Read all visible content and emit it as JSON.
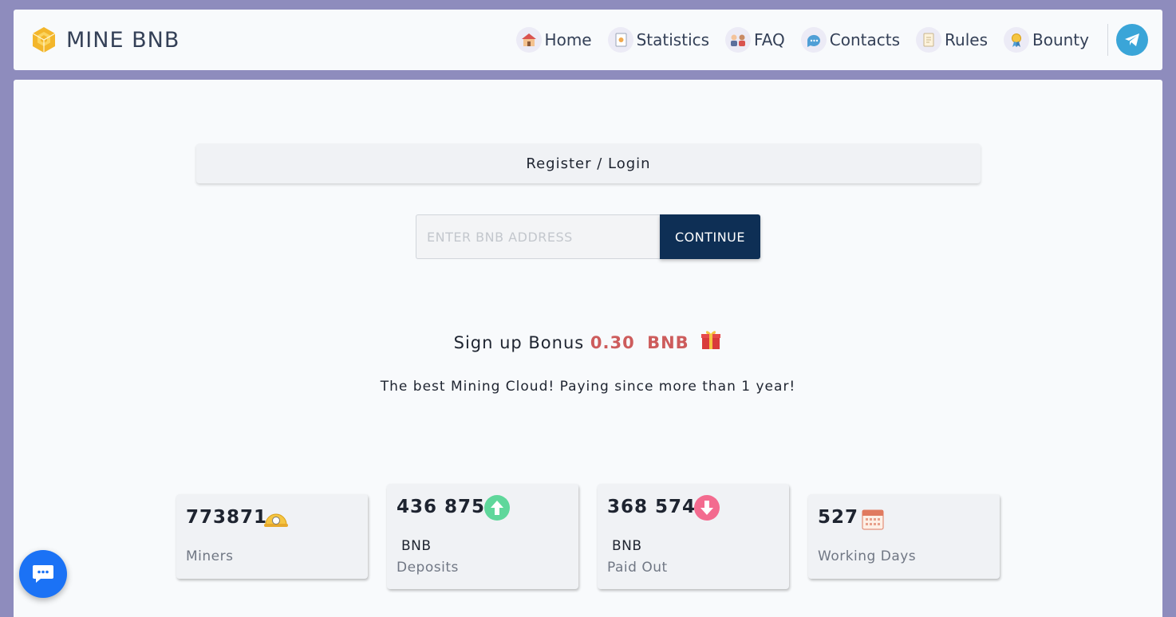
{
  "header": {
    "brand_name": "MINE BNB",
    "nav": [
      {
        "label": "Home",
        "icon": "home-icon"
      },
      {
        "label": "Statistics",
        "icon": "statistics-icon"
      },
      {
        "label": "FAQ",
        "icon": "faq-icon"
      },
      {
        "label": "Contacts",
        "icon": "contacts-icon"
      },
      {
        "label": "Rules",
        "icon": "rules-icon"
      },
      {
        "label": "Bounty",
        "icon": "bounty-icon"
      }
    ],
    "telegram_icon": "telegram-icon"
  },
  "main": {
    "register_label": "Register / Login",
    "address_placeholder": "ENTER BNB ADDRESS",
    "address_value": "",
    "continue_label": "CONTINUE",
    "bonus": {
      "prefix": "Sign up Bonus",
      "amount": "0.30",
      "currency": "BNB"
    },
    "tagline": "The best Mining Cloud! Paying since more than 1 year!"
  },
  "stats": [
    {
      "value": "773871",
      "unit": "",
      "label": "Miners",
      "icon": "miner-helmet-icon"
    },
    {
      "value": "436 875",
      "unit": "BNB",
      "label": "Deposits",
      "icon": "arrow-up-icon"
    },
    {
      "value": "368 574",
      "unit": "BNB",
      "label": "Paid Out",
      "icon": "arrow-down-icon"
    },
    {
      "value": "527",
      "unit": "",
      "label": "Working Days",
      "icon": "calendar-icon"
    }
  ],
  "colors": {
    "background": "#8e8cbd",
    "primary_button": "#0e2f55",
    "bonus_accent": "#cd5c5c",
    "deposit_green": "#5fd79b",
    "payout_pink": "#f36b8f",
    "telegram_blue": "#3aa5d8",
    "chat_blue": "#1b72f5"
  },
  "chat_icon": "chat-bubble-icon"
}
